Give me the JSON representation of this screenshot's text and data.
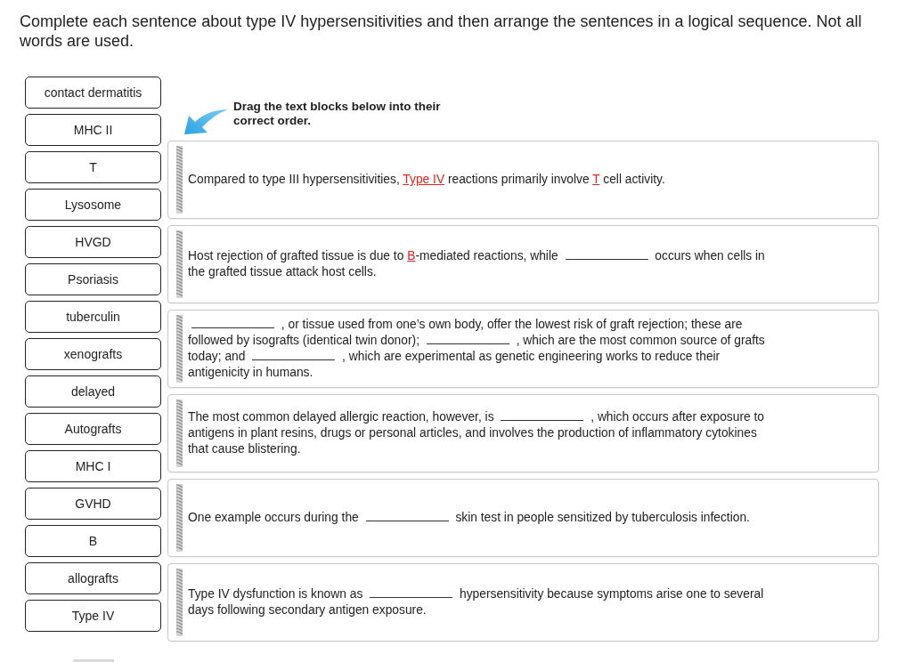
{
  "instructions": "Complete each sentence about type IV hypersensitivities and then arrange the sentences in a logical sequence. Not all words are used.",
  "word_bank": [
    "contact dermatitis",
    "MHC II",
    "T",
    "Lysosome",
    "HVGD",
    "Psoriasis",
    "tuberculin",
    "xenografts",
    "delayed",
    "Autografts",
    "MHC I",
    "GVHD",
    "B",
    "allografts",
    "Type IV"
  ],
  "hint": "Drag the text blocks below into their correct order.",
  "sentences": [
    {
      "parts": [
        {
          "kind": "text",
          "text": "Compared to type III hypersensitivities, "
        },
        {
          "kind": "answer",
          "text": "Type IV"
        },
        {
          "kind": "text",
          "text": " reactions primarily involve "
        },
        {
          "kind": "answer",
          "text": "T"
        },
        {
          "kind": "text",
          "text": " cell activity."
        }
      ]
    },
    {
      "parts": [
        {
          "kind": "text",
          "text": "Host rejection of grafted tissue is due to "
        },
        {
          "kind": "answer",
          "text": "B"
        },
        {
          "kind": "text",
          "text": "-mediated reactions, while "
        },
        {
          "kind": "blank"
        },
        {
          "kind": "text",
          "text": " occurs when cells in the grafted tissue attack host cells."
        }
      ]
    },
    {
      "parts": [
        {
          "kind": "blank"
        },
        {
          "kind": "text",
          "text": " , or tissue used from one’s own body, offer the lowest risk of graft rejection; these are followed by isografts (identical twin donor); "
        },
        {
          "kind": "blank"
        },
        {
          "kind": "text",
          "text": " , which are the most common source of grafts today; and "
        },
        {
          "kind": "blank"
        },
        {
          "kind": "text",
          "text": " , which are experimental as genetic engineering works to reduce their antigenicity in humans."
        }
      ]
    },
    {
      "parts": [
        {
          "kind": "text",
          "text": "The most common delayed allergic reaction, however, is "
        },
        {
          "kind": "blank"
        },
        {
          "kind": "text",
          "text": " , which occurs after exposure to antigens in plant resins, drugs or personal articles, and involves the production of inflammatory cytokines that cause blistering."
        }
      ]
    },
    {
      "parts": [
        {
          "kind": "text",
          "text": "One example occurs during the "
        },
        {
          "kind": "blank"
        },
        {
          "kind": "text",
          "text": " skin test in people sensitized by tuberculosis infection."
        }
      ]
    },
    {
      "parts": [
        {
          "kind": "text",
          "text": "Type IV dysfunction is known as "
        },
        {
          "kind": "blank"
        },
        {
          "kind": "text",
          "text": " hypersensitivity because symptoms arise one to several days following secondary antigen exposure."
        }
      ]
    }
  ]
}
